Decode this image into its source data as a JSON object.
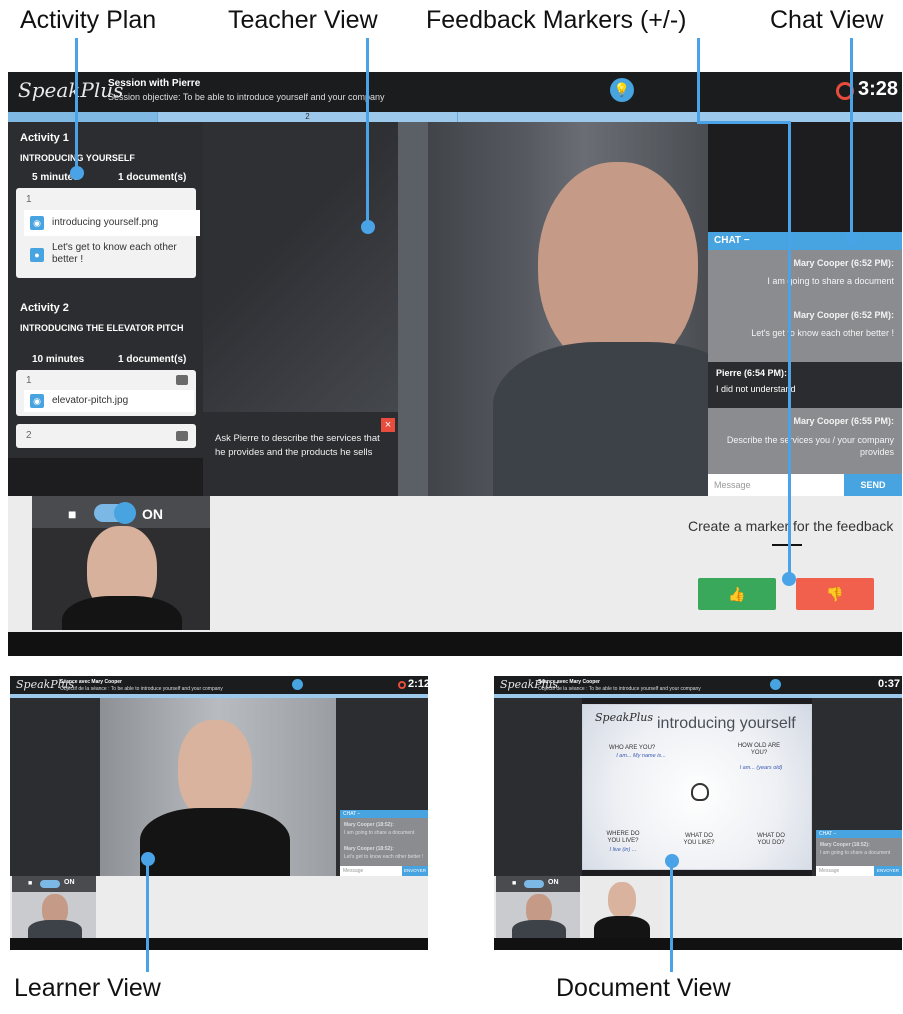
{
  "callouts": {
    "activity_plan": "Activity Plan",
    "teacher_view": "Teacher View",
    "feedback_markers": "Feedback Markers (+/-)",
    "chat_view": "Chat View",
    "learner_view": "Learner View",
    "document_view": "Document View"
  },
  "main": {
    "logo": "SpeakPlus",
    "session_title": "Session with Pierre",
    "session_objective": "Session objective: To be able to introduce yourself and your company",
    "timer": "3:28",
    "progress_step": "2",
    "activities": [
      {
        "title": "Activity 1",
        "name": "INTRODUCING YOURSELF",
        "duration": "5 minutes",
        "docs": "1 document(s)",
        "group": "1",
        "items": [
          "introducing yourself.png",
          "Let's get to know each other better !"
        ]
      },
      {
        "title": "Activity 2",
        "name": "INTRODUCING THE ELEVATOR PITCH",
        "duration": "10 minutes",
        "docs": "1 document(s)",
        "group": "1",
        "items": [
          "elevator-pitch.jpg"
        ],
        "group2": "2"
      }
    ],
    "instruction": "Ask Pierre to describe the services that he provides and the products he sells",
    "instruction_close": "×",
    "chat": {
      "header": "CHAT −",
      "messages": [
        {
          "author": "Mary Cooper (6:52 PM):",
          "text": "I am going to share a document"
        },
        {
          "author": "Mary Cooper (6:52 PM):",
          "text": "Let's get to know each other better !"
        },
        {
          "author": "Pierre (6:54 PM):",
          "text": "I did not understand"
        },
        {
          "author": "Mary Cooper (6:55 PM):",
          "text": "Describe the services you / your company provides"
        }
      ],
      "input_placeholder": "Message",
      "send_label": "SEND"
    },
    "camera_toggle": "ON",
    "feedback_prompt": "Create a marker for the feedback",
    "thumb_up": "👍",
    "thumb_down": "👎"
  },
  "learner": {
    "logo": "SpeakPlus",
    "session_title": "Séance avec Mary Cooper",
    "session_objective": "Objectif de la séance : To be able to introduce yourself and your company",
    "timer": "2:12",
    "chat_header": "CHAT −",
    "messages": [
      {
        "author": "Mary Cooper (18:52):",
        "text": "I am going to share a document"
      },
      {
        "author": "Mary Cooper (18:52):",
        "text": "Let's get to know each other better !"
      }
    ],
    "input_placeholder": "Message",
    "send_label": "ENVOYER",
    "camera_toggle": "ON"
  },
  "document": {
    "logo": "SpeakPlus",
    "session_title": "Séance avec Mary Cooper",
    "session_objective": "Objectif de la séance : To be able to introduce yourself and your company",
    "timer": "0:37",
    "doc_logo": "SpeakPlus",
    "doc_title": "introducing yourself",
    "q1": "WHO ARE YOU?",
    "a1": "I am... My name is...",
    "q2": "HOW OLD ARE YOU?",
    "a2": "I am... (years old)",
    "q3": "WHERE DO YOU LIVE?",
    "a3": "I live (in) ...",
    "q4": "WHAT DO YOU LIKE?",
    "q5": "WHAT DO YOU DO?",
    "chat_header": "CHAT −",
    "message_author": "Mary Cooper (18:52):",
    "message_text": "I am going to share a document",
    "input_placeholder": "Message",
    "send_label": "ENVOYER",
    "camera_toggle": "ON"
  },
  "colors": {
    "accent": "#47a4e0",
    "positive": "#3aa85a",
    "negative": "#f0604c",
    "timer_icon": "#e74c3c"
  }
}
